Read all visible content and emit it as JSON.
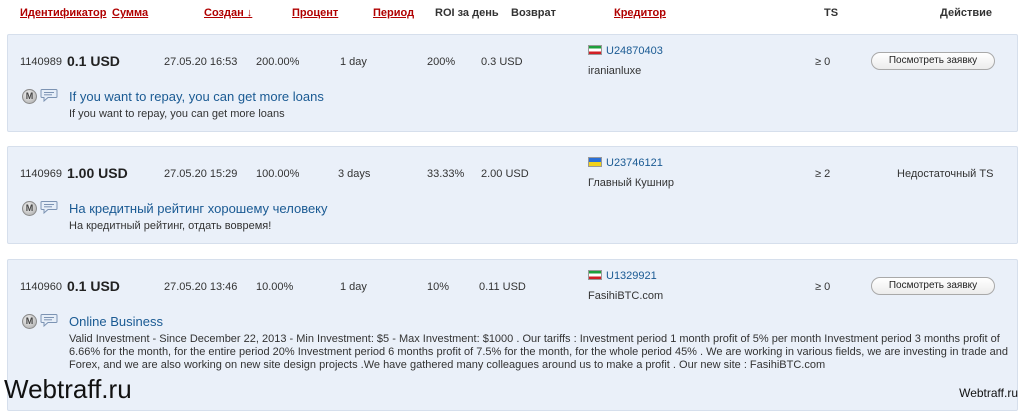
{
  "header": {
    "col_id": "Идентификатор",
    "col_amount": "Сумма",
    "col_created": "Создан ↓",
    "col_percent": "Процент",
    "col_period": "Период",
    "col_roi": "ROI за день",
    "col_return": "Возврат",
    "col_lender": "Кредитор",
    "col_ts": "TS",
    "col_action": "Действие"
  },
  "loans": [
    {
      "id": "1140989",
      "amount": "0.1 USD",
      "created": "27.05.20 16:53",
      "percent": "200.00%",
      "period": "1 day",
      "roi": "200%",
      "return": "0.3 USD",
      "lender_id": "U24870403",
      "lender_name": "iranianluxe",
      "flag": "iran-flag",
      "ts": "≥ 0",
      "action": "Посмотреть заявку",
      "title": "If you want to repay, you can get more loans",
      "description": "If you want to repay, you can get more loans"
    },
    {
      "id": "1140969",
      "amount": "1.00 USD",
      "created": "27.05.20 15:29",
      "percent": "100.00%",
      "period": "3 days",
      "roi": "33.33%",
      "return": "2.00 USD",
      "lender_id": "U23746121",
      "lender_name": "Главный Кушнир",
      "flag": "ukraine-flag",
      "ts": "≥ 2",
      "action": "Недостаточный TS",
      "title": "На кредитный рейтинг хорошему человеку",
      "description": "На кредитный рейтинг, отдать вовремя!"
    },
    {
      "id": "1140960",
      "amount": "0.1 USD",
      "created": "27.05.20 13:46",
      "percent": "10.00%",
      "period": "1 day",
      "roi": "10%",
      "return": "0.11 USD",
      "lender_id": "U1329921",
      "lender_name": "FasihiBTC.com",
      "flag": "iran-flag",
      "ts": "≥ 0",
      "action": "Посмотреть заявку",
      "title": "Online Business",
      "description": "Valid Investment - Since December 22, 2013 - Min Investment: $5 - Max Investment: $1000 . Our tariffs : Investment period 1 month profit of 5% per month Investment period 3 months profit of 6.66% for the month, for the entire period 20% Investment period 6 months profit of 7.5% for the month, for the whole period 45% . We are working in various fields, we are investing in trade and Forex, and we are also working on new site design projects .We have gathered many colleagues around us to make a profit . Our new site : FasihiBTC.com"
    }
  ],
  "icons": {
    "m": "M"
  },
  "watermark": {
    "left": "Webtraff.ru",
    "right": "Webtraff.ru"
  }
}
